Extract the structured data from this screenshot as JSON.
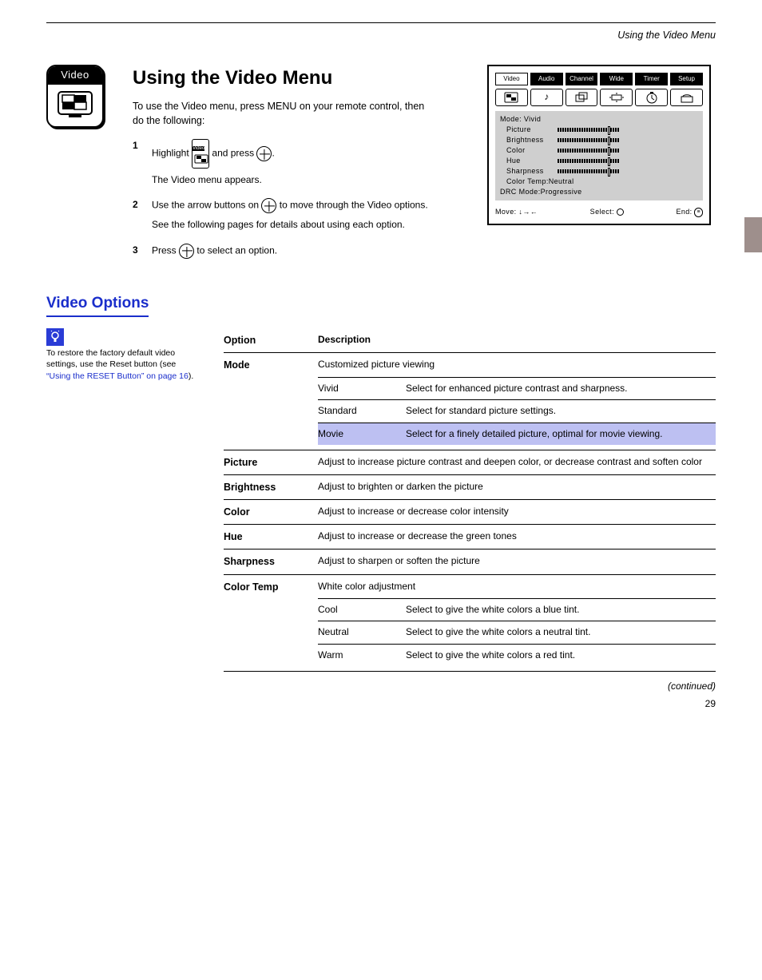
{
  "running_head": "Using the Video Menu",
  "video_badge_label": "Video",
  "section_title": "Using the Video Menu",
  "intro_1": "To use the Video menu, press MENU on your remote control, then do the following:",
  "steps": [
    {
      "num": "1",
      "first_a": "Highlight",
      "first_b": "and press",
      "first_c": ".",
      "sub": "The Video menu appears."
    },
    {
      "num": "2",
      "first_a": "Use the arrow buttons on",
      "first_b": "to move through the Video options.",
      "sub": "See the following pages for details about using each option."
    },
    {
      "num": "3",
      "first_a": "Press",
      "first_b": "to select an option.",
      "sub": ""
    }
  ],
  "osd": {
    "tabs": [
      "Video",
      "Audio",
      "Channel",
      "Wide",
      "Timer",
      "Setup"
    ],
    "mode": "Mode: Vivid",
    "lines": [
      "Picture",
      "Brightness",
      "Color",
      "Hue",
      "Sharpness"
    ],
    "ct": "Color Temp:Neutral",
    "drc": "DRC Mode:Progressive",
    "footer_move": "Move:",
    "footer_arrows": "↓→←",
    "footer_select": "Select:",
    "footer_end": "End:"
  },
  "options_heading": "Video Options",
  "tip": {
    "line1": "To restore the factory default video",
    "line2_a": "settings, use the Reset button (see ",
    "line2_link": "“Using the RESET Button” on page 16",
    "line2_b": ")."
  },
  "options": [
    {
      "label": "Option",
      "desc": "Description",
      "is_header": true
    },
    {
      "label": "Mode",
      "desc": "Customized picture viewing",
      "subs": [
        {
          "k": "Vivid",
          "v": "Select for enhanced picture contrast and sharpness."
        },
        {
          "k": "Standard",
          "v": "Select for standard picture settings."
        },
        {
          "k": "Movie",
          "v": "Select for a finely detailed picture, optimal for movie viewing.",
          "hl": true
        }
      ]
    },
    {
      "label": "Picture",
      "desc": "Adjust to increase picture contrast and deepen color, or decrease contrast and soften color"
    },
    {
      "label": "Brightness",
      "desc": "Adjust to brighten or darken the picture"
    },
    {
      "label": "Color",
      "desc": "Adjust to increase or decrease color intensity"
    },
    {
      "label": "Hue",
      "desc": "Adjust to increase or decrease the green tones"
    },
    {
      "label": "Sharpness",
      "desc": "Adjust to sharpen or soften the picture"
    },
    {
      "label": "Color Temp",
      "desc": "White color adjustment",
      "subs": [
        {
          "k": "Cool",
          "v": "Select to give the white colors a blue tint."
        },
        {
          "k": "Neutral",
          "v": "Select to give the white colors a neutral tint."
        },
        {
          "k": "Warm",
          "v": "Select to give the white colors a red tint."
        }
      ]
    }
  ],
  "continued": "(continued)",
  "page_number": "29"
}
